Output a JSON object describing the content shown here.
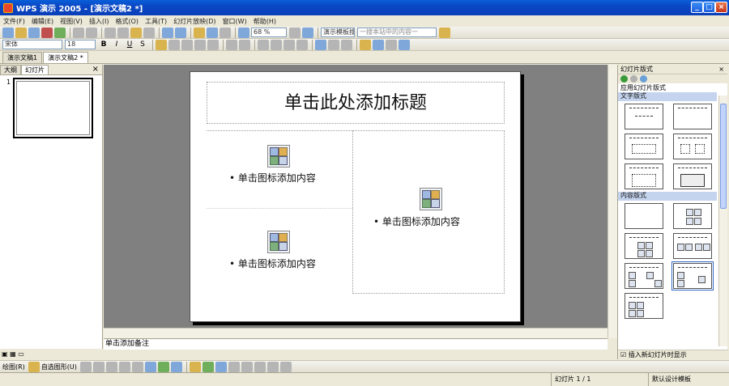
{
  "window": {
    "title": "WPS 演示 2005 - [演示文稿2 *]",
    "minimize": "_",
    "maximize": "□",
    "close": "×"
  },
  "menu": [
    "文件(F)",
    "编辑(E)",
    "视图(V)",
    "插入(I)",
    "格式(O)",
    "工具(T)",
    "幻灯片放映(D)",
    "窗口(W)",
    "帮助(H)"
  ],
  "toolbar1": {
    "zoom": "68 %",
    "search_placeholder": "一搜本站中的内容一",
    "search_engine": "演示模板搜索"
  },
  "toolbar2": {
    "font": "宋体",
    "size": "18",
    "bold": "B",
    "italic": "I",
    "underline": "U",
    "shadow": "S"
  },
  "doc_tabs": [
    "演示文稿1",
    "演示文稿2 *"
  ],
  "left_panel": {
    "tabs": [
      "大纲",
      "幻灯片"
    ],
    "close": "×",
    "slide_number": "1"
  },
  "slide": {
    "title": "单击此处添加标题",
    "content_top_left": "单击图标添加内容",
    "content_bottom_left": "单击图标添加内容",
    "content_right": "单击图标添加内容"
  },
  "notes_placeholder": "单击添加备注",
  "right_panel": {
    "title": "幻灯片版式",
    "close": "×",
    "apply_label": "应用幻灯片版式",
    "section_text": "文字版式",
    "section_content": "内容版式",
    "footer": "插入新幻灯片时显示"
  },
  "drawbar": {
    "draw_label": "绘图(R)",
    "autoshapes_label": "自选图形(U)"
  },
  "statusbar": {
    "slide_info": "幻灯片 1 / 1",
    "template": "默认设计模板"
  },
  "colors": {
    "titlebar": "#0a46c4",
    "workarea": "#808080",
    "section": "#c5d4ee"
  }
}
